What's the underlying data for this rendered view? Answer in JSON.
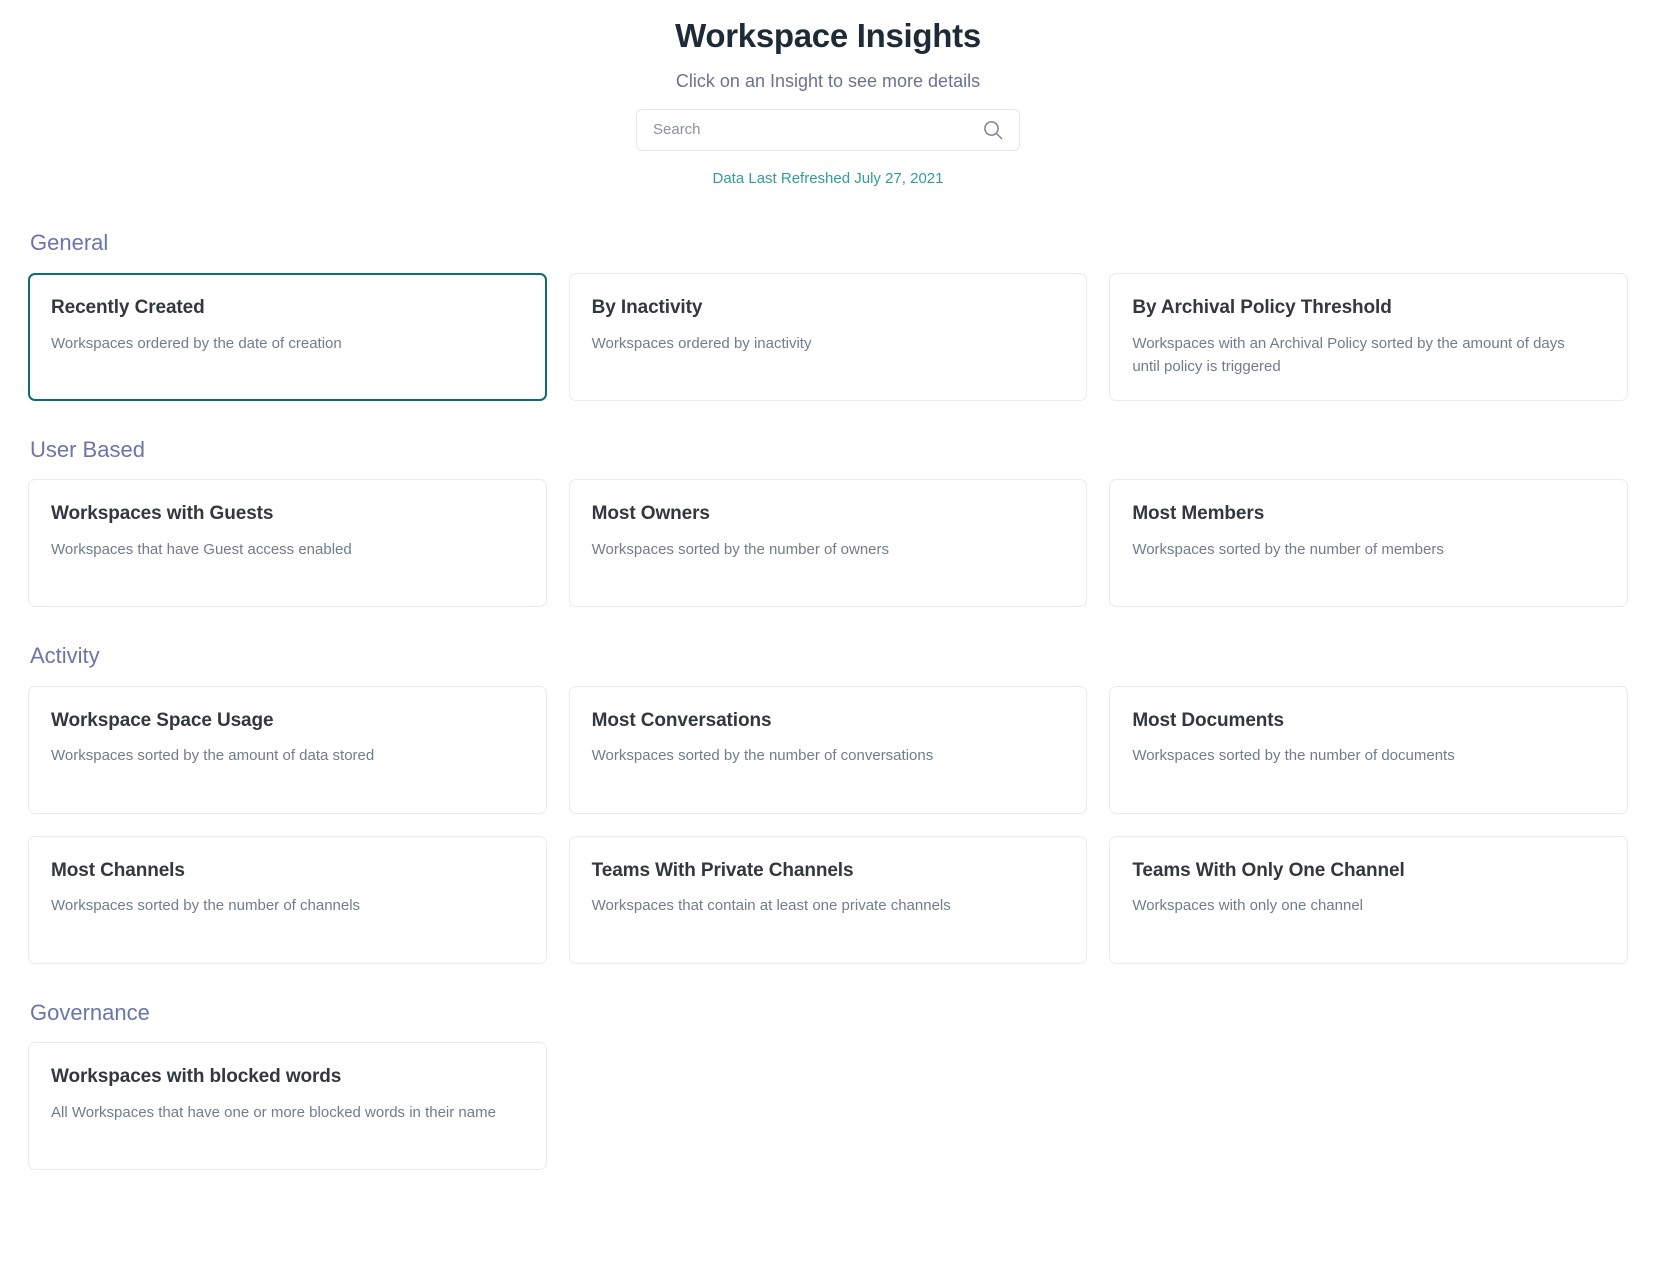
{
  "header": {
    "title": "Workspace Insights",
    "subtitle": "Click on an Insight to see more details",
    "refresh_note": "Data Last Refreshed July 27, 2021"
  },
  "search": {
    "placeholder": "Search",
    "value": "",
    "icon": "search-icon"
  },
  "colors": {
    "selected_border": "#0b6e75",
    "card_border": "#e7ebf0",
    "section_heading": "#6a74ad",
    "refresh_link": "#2f9d9c",
    "title": "#1c2b36",
    "subtitle": "#6a7194",
    "card_title": "#33383d",
    "card_desc": "#6f7d8c"
  },
  "sections": [
    {
      "title": "General",
      "cards": [
        {
          "title": "Recently Created",
          "desc": "Workspaces ordered by the date of creation",
          "selected": true
        },
        {
          "title": "By Inactivity",
          "desc": "Workspaces ordered by inactivity",
          "selected": false
        },
        {
          "title": "By Archival Policy Threshold",
          "desc": "Workspaces with an Archival Policy sorted by the amount of days until policy is triggered",
          "selected": false
        }
      ]
    },
    {
      "title": "User Based",
      "cards": [
        {
          "title": "Workspaces with Guests",
          "desc": "Workspaces that have Guest access enabled",
          "selected": false
        },
        {
          "title": "Most Owners",
          "desc": "Workspaces sorted by the number of owners",
          "selected": false
        },
        {
          "title": "Most Members",
          "desc": "Workspaces sorted by the number of members",
          "selected": false
        }
      ]
    },
    {
      "title": "Activity",
      "cards": [
        {
          "title": "Workspace Space Usage",
          "desc": "Workspaces sorted by the amount of data stored",
          "selected": false
        },
        {
          "title": "Most Conversations",
          "desc": "Workspaces sorted by the number of conversations",
          "selected": false
        },
        {
          "title": "Most Documents",
          "desc": "Workspaces sorted by the number of documents",
          "selected": false
        },
        {
          "title": "Most Channels",
          "desc": "Workspaces sorted by the number of channels",
          "selected": false
        },
        {
          "title": "Teams With Private Channels",
          "desc": "Workspaces that contain at least one private channels",
          "selected": false
        },
        {
          "title": "Teams With Only One Channel",
          "desc": "Workspaces with only one channel",
          "selected": false
        }
      ]
    },
    {
      "title": "Governance",
      "cards": [
        {
          "title": "Workspaces with blocked words",
          "desc": "All Workspaces that have one or more blocked words in their name",
          "selected": false
        }
      ]
    }
  ]
}
